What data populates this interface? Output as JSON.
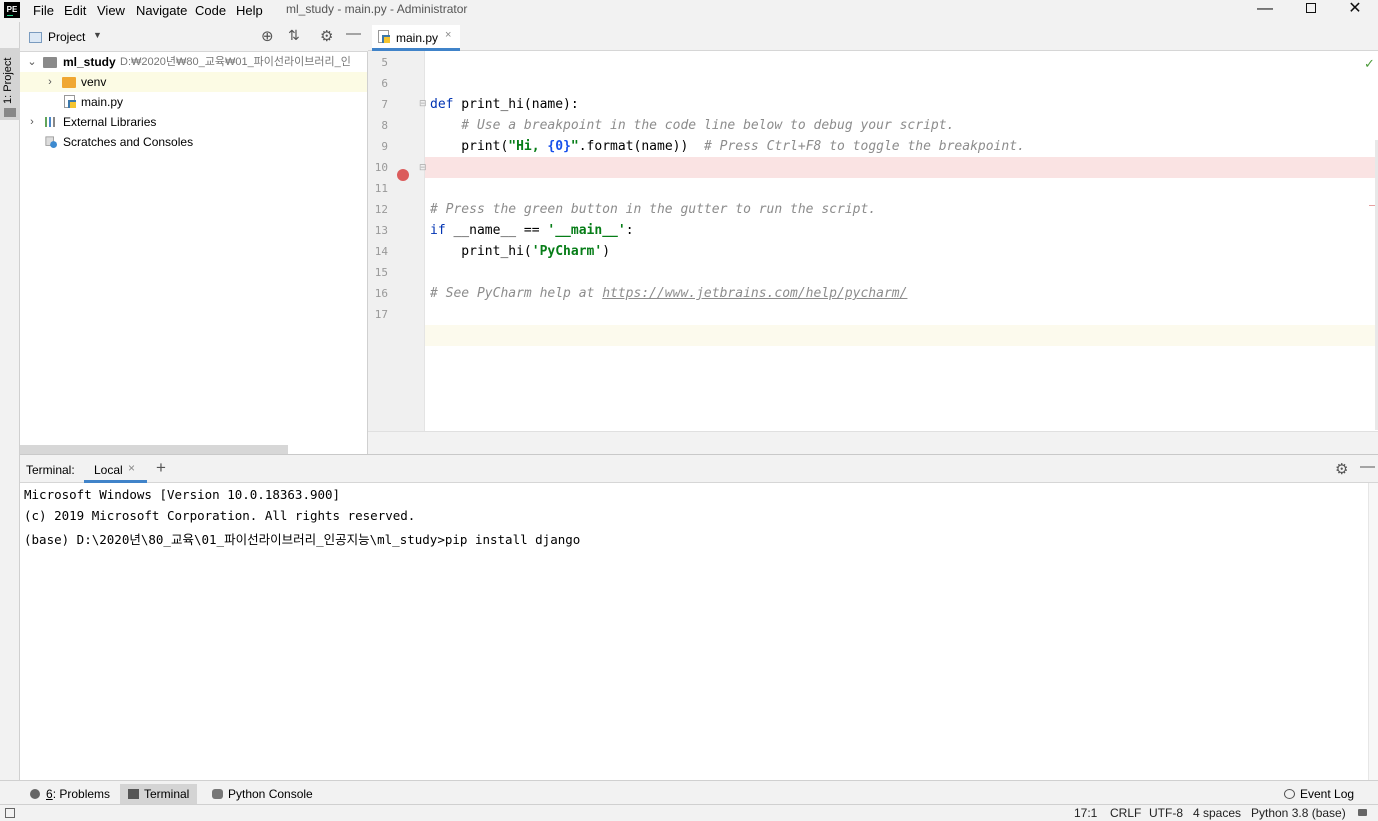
{
  "window": {
    "app_logo": "PE",
    "title": "ml_study - main.py - Administrator",
    "menu": [
      "File",
      "Edit",
      "View",
      "Navigate",
      "Code",
      "Help"
    ]
  },
  "left_stripe": {
    "project_label": "1: Project"
  },
  "project_panel": {
    "header_label": "Project",
    "tree": [
      {
        "name": "ml_study",
        "path": "D:₩2020년₩80_교육₩01_파이선라이브러리_인",
        "type": "module",
        "expanded": true
      },
      {
        "name": "venv",
        "type": "folder",
        "expanded": false
      },
      {
        "name": "main.py",
        "type": "python-file"
      },
      {
        "name": "External Libraries",
        "type": "library"
      },
      {
        "name": "Scratches and Consoles",
        "type": "scratches"
      }
    ]
  },
  "editor": {
    "tab_label": "main.py",
    "line_numbers": [
      "5",
      "6",
      "7",
      "8",
      "9",
      "10",
      "11",
      "12",
      "13",
      "14",
      "15",
      "16",
      "17"
    ],
    "code": {
      "l7_kw": "def",
      "l7_rest": " print_hi(name):",
      "l8": "    # Use a breakpoint in the code line below to debug your script.",
      "l9_a": "    print(",
      "l9_str": "\"Hi, ",
      "l9_fmt": "{0}",
      "l9_str2": "\"",
      "l9_b": ".format(name))  ",
      "l9_cm": "# Press Ctrl+F8 to toggle the breakpoint.",
      "l12": "# Press the green button in the gutter to run the script.",
      "l13_kw": "if",
      "l13_rest": " __name__ == ",
      "l13_str": "'__main__'",
      "l13_end": ":",
      "l14_a": "    print_hi(",
      "l14_str": "'PyCharm'",
      "l14_end": ")",
      "l16_cm": "# See PyCharm help at ",
      "l16_link": "https://www.jetbrains.com/help/pycharm/"
    },
    "breakpoint_line": "9",
    "caret_line": "17"
  },
  "terminal": {
    "label": "Terminal:",
    "tab_local": "Local",
    "lines": [
      "Microsoft Windows [Version 10.0.18363.900]",
      "(c) 2019 Microsoft Corporation. All rights reserved.",
      "(base) D:\\2020년\\80_교육\\01_파이선라이브러리_인공지능\\ml_study>pip install django"
    ]
  },
  "tool_windows": {
    "problems_prefix": "6",
    "problems": ": Problems",
    "terminal": "Terminal",
    "python_console": "Python Console",
    "event_log": "Event Log"
  },
  "status_bar": {
    "caret": "17:1",
    "line_sep": "CRLF",
    "encoding": "UTF-8",
    "indent": "4 spaces",
    "interpreter": "Python 3.8 (base)"
  },
  "colors": {
    "accent": "#4083c9",
    "breakpoint": "#db5c5c",
    "breakpoint_line_bg": "#fae3e3",
    "caret_line_bg": "#fcfaed",
    "folder": "#f0a732",
    "check": "#4c9b3b"
  }
}
